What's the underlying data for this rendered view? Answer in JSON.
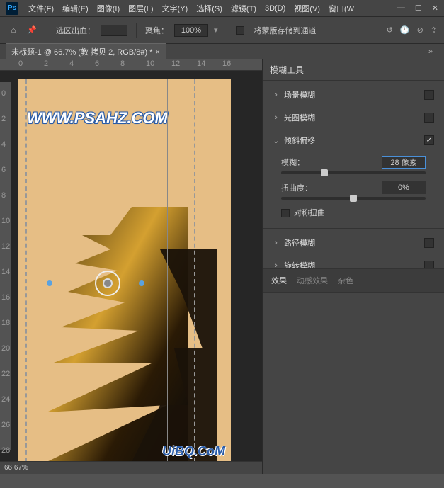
{
  "menu": {
    "items": [
      "文件(F)",
      "编辑(E)",
      "图像(I)",
      "图层(L)",
      "文字(Y)",
      "选择(S)",
      "滤镜(T)",
      "3D(D)",
      "视图(V)",
      "窗口(W"
    ]
  },
  "toolbar": {
    "sel_label": "选区出血：",
    "focus_label": "聚焦：",
    "focus_value": "100%",
    "save_mask": "将蒙版存储到通道"
  },
  "doc_tab": "未标题-1 @ 66.7% (教 拷贝 2, RGB/8#) *",
  "zoom": "66.67%",
  "ruler_h": [
    "0",
    "2",
    "4",
    "6",
    "8",
    "10",
    "12",
    "14",
    "16"
  ],
  "ruler_v": [
    "0",
    "2",
    "4",
    "6",
    "8",
    "10",
    "12",
    "14",
    "16",
    "18",
    "20",
    "22",
    "24",
    "26",
    "28"
  ],
  "canvas": {
    "watermark_top": "WWW.PSAHZ.COM",
    "watermark_bot": "UiBQ.CoM"
  },
  "panel": {
    "title": "模糊工具",
    "sections": {
      "field": {
        "label": "场景模糊",
        "enabled": false
      },
      "iris": {
        "label": "光圈模糊",
        "enabled": false
      },
      "tilt": {
        "label": "倾斜偏移",
        "enabled": true,
        "blur": {
          "label": "模糊：",
          "value": "28 像素",
          "percent": 30
        },
        "distort": {
          "label": "扭曲度：",
          "value": "0%",
          "percent": 50
        },
        "sym": {
          "label": "对称扭曲"
        }
      },
      "path": {
        "label": "路径模糊",
        "enabled": false
      },
      "spin": {
        "label": "旋转模糊",
        "enabled": false
      }
    },
    "tabs": [
      "效果",
      "动感效果",
      "杂色"
    ]
  }
}
